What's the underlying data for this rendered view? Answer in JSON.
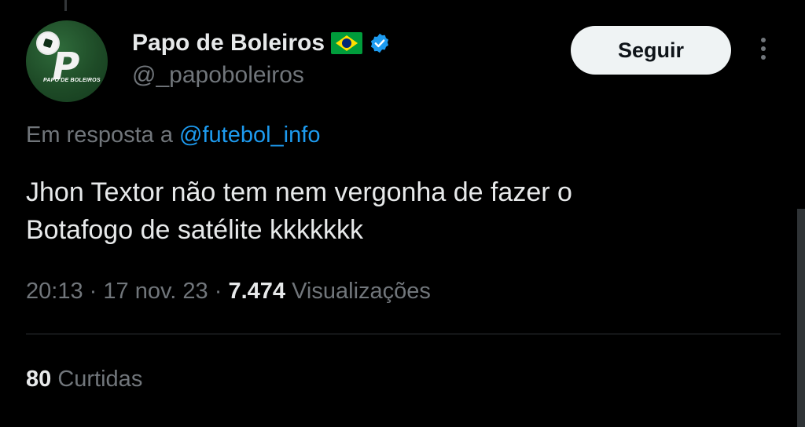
{
  "author": {
    "display_name": "Papo de Boleiros",
    "handle": "@_papoboleiros",
    "avatar_caption": "PAPO DE BOLEIROS",
    "avatar_mark": "P",
    "flag_icon": "brazil-flag-icon",
    "verified_icon": "verified-badge-icon",
    "verified_color": "#1d9bf0"
  },
  "follow_button": {
    "label": "Seguir"
  },
  "reply": {
    "prefix": "Em resposta a",
    "mention": "@futebol_info"
  },
  "tweet": {
    "lines": [
      "Jhon Textor não tem nem vergonha de fazer o",
      "Botafogo de satélite kkkkkkk"
    ]
  },
  "meta": {
    "time": "20:13",
    "separator": "·",
    "date": "17 nov. 23",
    "views_count": "7.474",
    "views_label": "Visualizações"
  },
  "stats": {
    "likes_count": "80",
    "likes_label": "Curtidas"
  },
  "colors": {
    "background": "#000000",
    "text_primary": "#e7e9ea",
    "text_secondary": "#71767b",
    "link": "#1d9bf0",
    "button_bg": "#eff3f4"
  }
}
